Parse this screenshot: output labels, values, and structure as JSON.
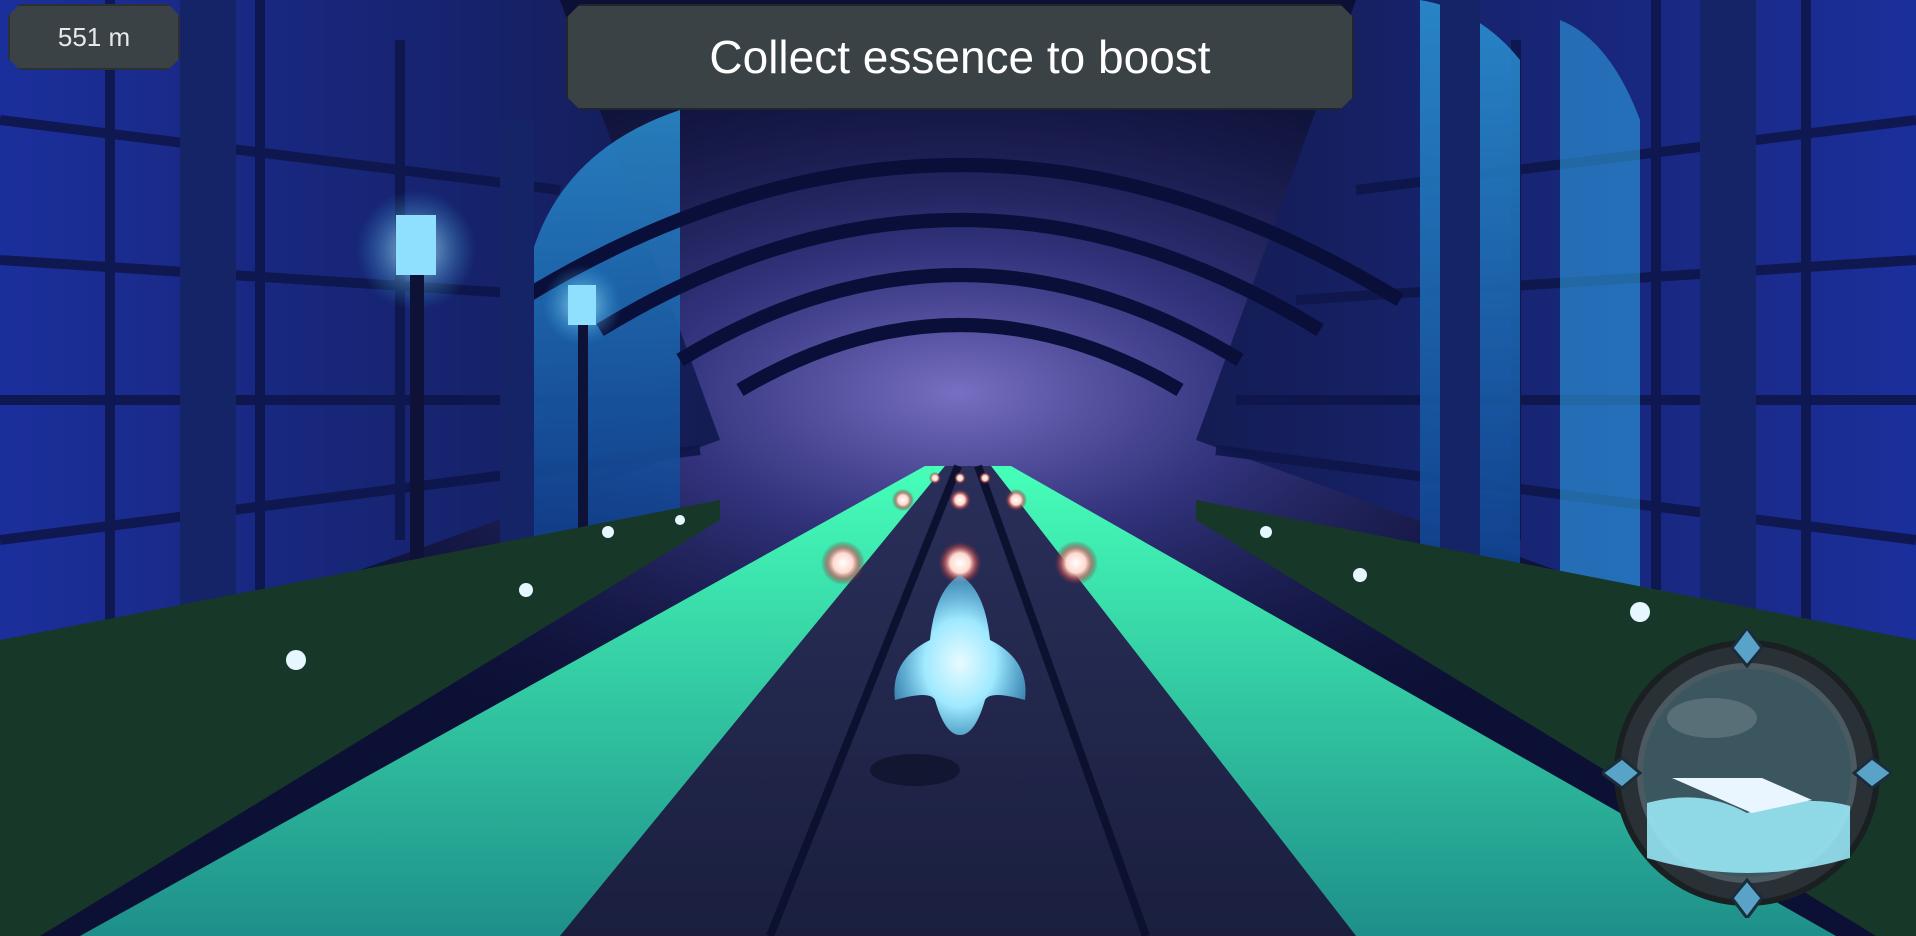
{
  "hud": {
    "distance": "551 m",
    "hint": "Collect essence to boost"
  },
  "scene": {
    "environment": "night stone corridor with glowing green water channels",
    "player": "glowing ghost spirit",
    "collectibles": "essence orbs"
  },
  "colors": {
    "hud_bg": "#3b4246",
    "hud_text": "#ffffff",
    "water_glow": "#3df2b0",
    "ghost": "#9fe9ff",
    "wall": "#1a2b7a"
  },
  "icons": {
    "radar": "crystal-ball-radar-icon",
    "essence": "essence-orb-icon"
  }
}
